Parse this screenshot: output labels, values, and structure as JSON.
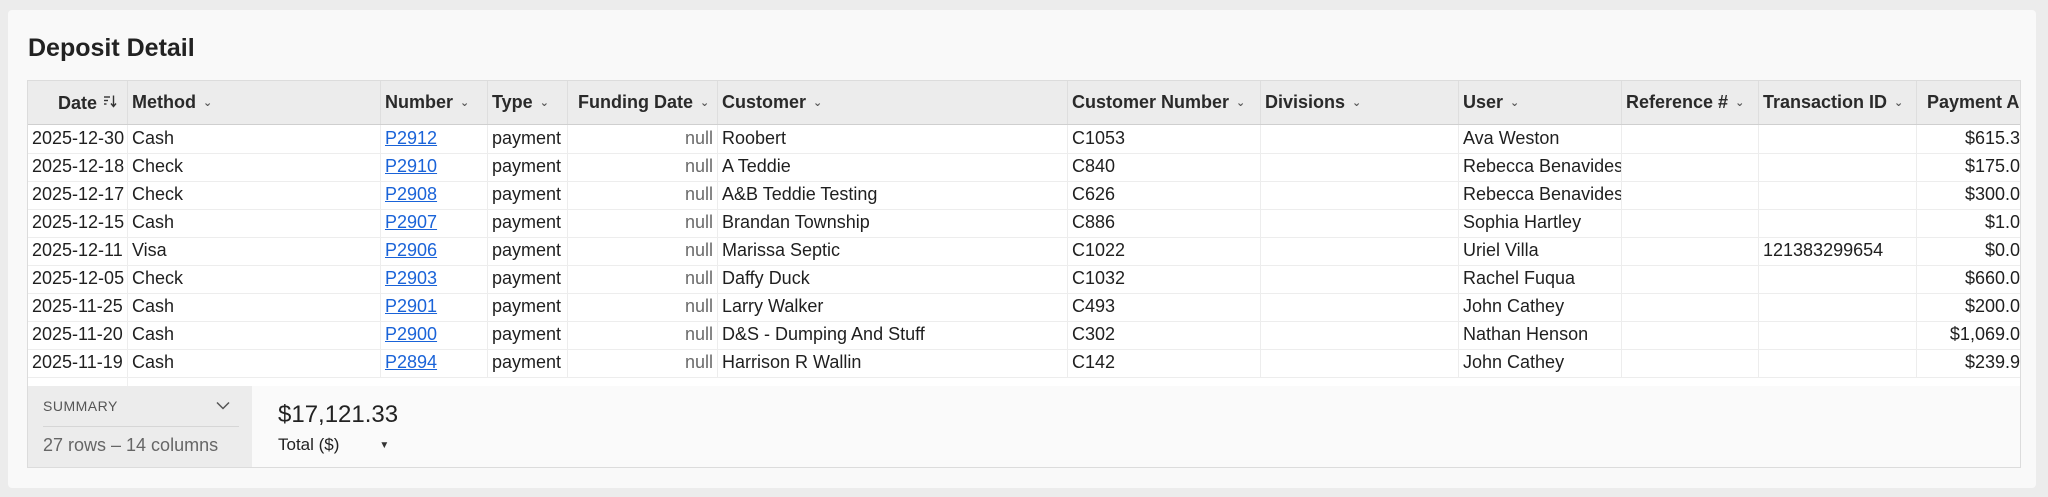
{
  "page": {
    "title": "Deposit Detail"
  },
  "table": {
    "columns": [
      {
        "key": "date",
        "label": "Date"
      },
      {
        "key": "method",
        "label": "Method"
      },
      {
        "key": "number",
        "label": "Number"
      },
      {
        "key": "type",
        "label": "Type"
      },
      {
        "key": "funding_date",
        "label": "Funding Date"
      },
      {
        "key": "customer",
        "label": "Customer"
      },
      {
        "key": "customer_number",
        "label": "Customer Number"
      },
      {
        "key": "divisions",
        "label": "Divisions"
      },
      {
        "key": "user",
        "label": "User"
      },
      {
        "key": "reference",
        "label": "Reference #"
      },
      {
        "key": "transaction_id",
        "label": "Transaction ID"
      },
      {
        "key": "payment_amt",
        "label": "Payment Amt"
      }
    ],
    "rows": [
      {
        "date": "2025-12-30",
        "method": "Cash",
        "number": "P2912",
        "type": "payment",
        "funding_date": "null",
        "customer": "Roobert",
        "customer_number": "C1053",
        "divisions": "",
        "user": "Ava Weston",
        "reference": "",
        "transaction_id": "",
        "payment_amt": "$615.3"
      },
      {
        "date": "2025-12-18",
        "method": "Check",
        "number": "P2910",
        "type": "payment",
        "funding_date": "null",
        "customer": "A Teddie",
        "customer_number": "C840",
        "divisions": "",
        "user": "Rebecca Benavides",
        "reference": "",
        "transaction_id": "",
        "payment_amt": "$175.0"
      },
      {
        "date": "2025-12-17",
        "method": "Check",
        "number": "P2908",
        "type": "payment",
        "funding_date": "null",
        "customer": "A&B Teddie Testing",
        "customer_number": "C626",
        "divisions": "",
        "user": "Rebecca Benavides",
        "reference": "",
        "transaction_id": "",
        "payment_amt": "$300.0"
      },
      {
        "date": "2025-12-15",
        "method": "Cash",
        "number": "P2907",
        "type": "payment",
        "funding_date": "null",
        "customer": "Brandan Township",
        "customer_number": "C886",
        "divisions": "",
        "user": "Sophia  Hartley",
        "reference": "",
        "transaction_id": "",
        "payment_amt": "$1.0"
      },
      {
        "date": "2025-12-11",
        "method": "Visa",
        "number": "P2906",
        "type": "payment",
        "funding_date": "null",
        "customer": "Marissa Septic",
        "customer_number": "C1022",
        "divisions": "",
        "user": "Uriel Villa",
        "reference": "",
        "transaction_id": "121383299654",
        "payment_amt": "$0.0"
      },
      {
        "date": "2025-12-05",
        "method": "Check",
        "number": "P2903",
        "type": "payment",
        "funding_date": "null",
        "customer": "Daffy Duck",
        "customer_number": "C1032",
        "divisions": "",
        "user": "Rachel Fuqua",
        "reference": "",
        "transaction_id": "",
        "payment_amt": "$660.0"
      },
      {
        "date": "2025-11-25",
        "method": "Cash",
        "number": "P2901",
        "type": "payment",
        "funding_date": "null",
        "customer": "Larry Walker",
        "customer_number": "C493",
        "divisions": "",
        "user": "John Cathey",
        "reference": "",
        "transaction_id": "",
        "payment_amt": "$200.0"
      },
      {
        "date": "2025-11-20",
        "method": "Cash",
        "number": "P2900",
        "type": "payment",
        "funding_date": "null",
        "customer": "D&S - Dumping And Stuff",
        "customer_number": "C302",
        "divisions": "",
        "user": "Nathan Henson",
        "reference": "",
        "transaction_id": "",
        "payment_amt": "$1,069.0"
      },
      {
        "date": "2025-11-19",
        "method": "Cash",
        "number": "P2894",
        "type": "payment",
        "funding_date": "null",
        "customer": "Harrison R Wallin",
        "customer_number": "C142",
        "divisions": "",
        "user": "John Cathey",
        "reference": "",
        "transaction_id": "",
        "payment_amt": "$239.9"
      }
    ]
  },
  "summary": {
    "label": "SUMMARY",
    "count": "27 rows – 14 columns",
    "total_value": "$17,121.33",
    "total_label": "Total ($)"
  }
}
